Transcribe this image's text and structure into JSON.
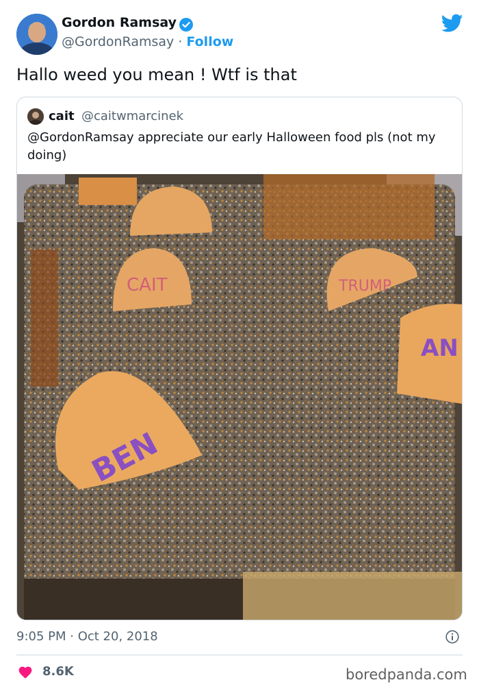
{
  "tweet": {
    "author_name": "Gordon Ramsay",
    "author_handle": "@GordonRamsay",
    "separator": "·",
    "follow_label": "Follow",
    "text": "Hallo weed you mean ! Wtf is that",
    "timestamp": "9:05 PM · Oct 20, 2018",
    "likes": "8.6K",
    "icons": {
      "verified": "verified-badge-icon",
      "logo": "twitter-bird-icon",
      "info": "info-icon",
      "like": "heart-icon"
    },
    "colors": {
      "accent": "#1d9bf0",
      "like": "#f91880",
      "muted": "#536471"
    }
  },
  "quoted": {
    "author_name": "cait",
    "author_handle": "@caitwmarcinek",
    "text": "@GordonRamsay appreciate our early Halloween food pls (not my doing)",
    "photo_text": {
      "tombstone_1": "CAIT",
      "tombstone_2": "TRUMP",
      "tombstone_3": "AN",
      "tombstone_4": "BEN"
    }
  },
  "watermark": "boredpanda.com"
}
